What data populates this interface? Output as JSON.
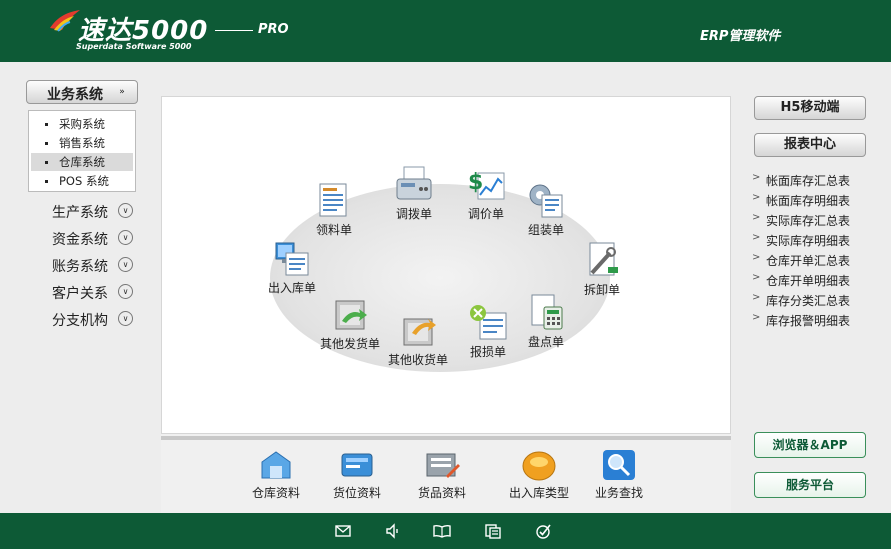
{
  "header": {
    "brand_title": "速达5000",
    "brand_pro": "PRO",
    "brand_subtitle": "Superdata Software 5000",
    "product": "ERP管理软件"
  },
  "sidebar": {
    "section_label": "业务系统",
    "submenu": [
      {
        "label": "采购系统",
        "selected": false
      },
      {
        "label": "销售系统",
        "selected": false
      },
      {
        "label": "仓库系统",
        "selected": true
      },
      {
        "label": "POS 系统",
        "selected": false
      }
    ],
    "modules": [
      "生产系统",
      "资金系统",
      "账务系统",
      "客户关系",
      "分支机构"
    ]
  },
  "workflow": {
    "items": [
      {
        "key": "lingliao",
        "label": "领料单",
        "icon": "document-list-icon"
      },
      {
        "key": "diaobo",
        "label": "调拨单",
        "icon": "fax-machine-icon"
      },
      {
        "key": "tiaojia",
        "label": "调价单",
        "icon": "price-chart-icon"
      },
      {
        "key": "zuzhuang",
        "label": "组装单",
        "icon": "gear-document-icon"
      },
      {
        "key": "chaixie",
        "label": "拆卸单",
        "icon": "wrench-document-icon"
      },
      {
        "key": "pandian",
        "label": "盘点单",
        "icon": "calculator-document-icon"
      },
      {
        "key": "baosun",
        "label": "报损单",
        "icon": "damaged-document-icon"
      },
      {
        "key": "qitashou",
        "label": "其他收货单",
        "icon": "inbound-box-icon"
      },
      {
        "key": "qitafa",
        "label": "其他发货单",
        "icon": "outbound-box-icon"
      },
      {
        "key": "churuku",
        "label": "出入库单",
        "icon": "monitor-document-icon"
      }
    ]
  },
  "toolbar": {
    "items": [
      {
        "label": "仓库资料",
        "icon": "warehouse-icon"
      },
      {
        "label": "货位资料",
        "icon": "location-card-icon"
      },
      {
        "label": "货品资料",
        "icon": "goods-pen-icon"
      },
      {
        "label": "出入库类型",
        "icon": "inout-type-icon"
      },
      {
        "label": "业务查找",
        "icon": "magnifier-icon"
      }
    ]
  },
  "right": {
    "mobile_button": "H5移动端",
    "report_button": "报表中心",
    "reports": [
      "帐面库存汇总表",
      "帐面库存明细表",
      "实际库存汇总表",
      "实际库存明细表",
      "仓库开单汇总表",
      "仓库开单明细表",
      "库存分类汇总表",
      "库存报警明细表"
    ],
    "browser_button": "浏览器＆APP",
    "service_button": "服务平台"
  },
  "statusbar": {
    "icons": [
      "mail-icon",
      "speaker-icon",
      "book-icon",
      "copy-icon",
      "check-circle-icon"
    ]
  },
  "colors": {
    "brand_green": "#0d5a36",
    "accent_orange": "#f0a020",
    "accent_blue": "#2a7fd4"
  }
}
